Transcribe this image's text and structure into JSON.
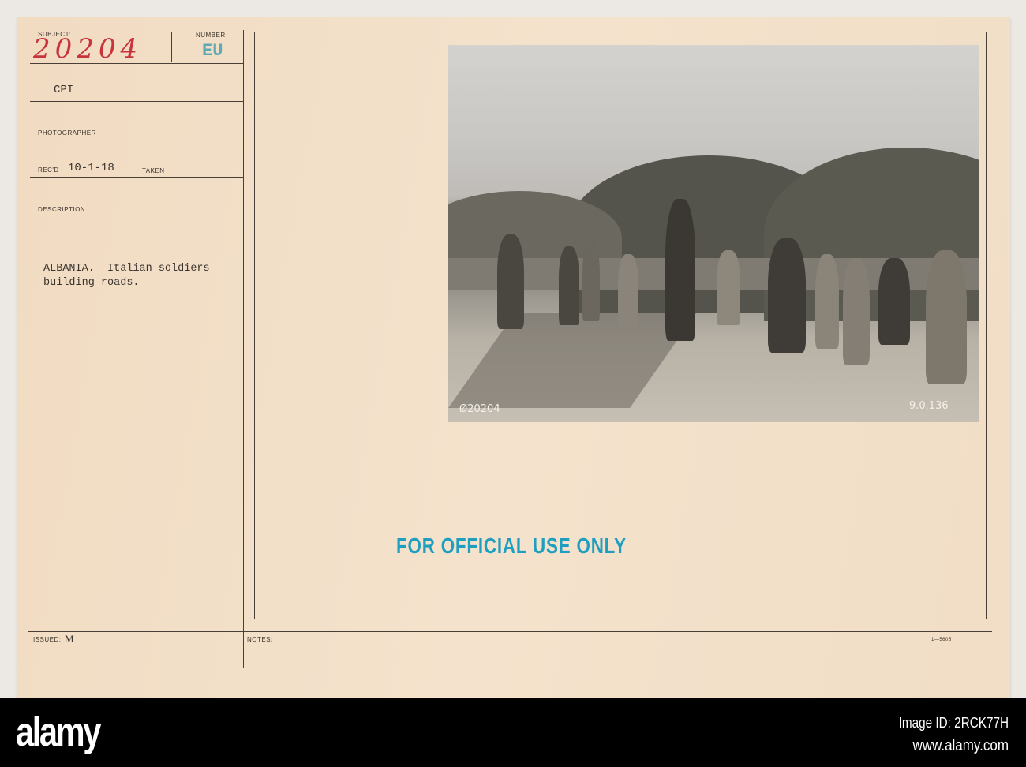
{
  "card": {
    "subject_label": "SUBJECT:",
    "subject_value": "20204",
    "number_label": "NUMBER",
    "number_value": "EU",
    "source": "CPI",
    "photographer_label": "PHOTOGRAPHER",
    "recd_label": "REC'D",
    "recd_value": "10-1-18",
    "taken_label": "TAKEN",
    "description_label": "DESCRIPTION",
    "description_line1": "ALBANIA.  Italian soldiers",
    "description_line2": "building roads.",
    "issued_label": "ISSUED:",
    "issued_value": "M",
    "notes_label": "NOTES:",
    "form_number": "1—5605"
  },
  "photo": {
    "negative_number": "Ø20204",
    "corner_number": "9.0.136"
  },
  "stamp": "FOR OFFICIAL USE ONLY",
  "footer": {
    "logo": "alamy",
    "image_id": "Image ID: 2RCK77H",
    "website": "www.alamy.com"
  },
  "colors": {
    "stamp": "#1f9fc0",
    "subject_ink": "#c9343c",
    "card": "#f3dfc6"
  }
}
